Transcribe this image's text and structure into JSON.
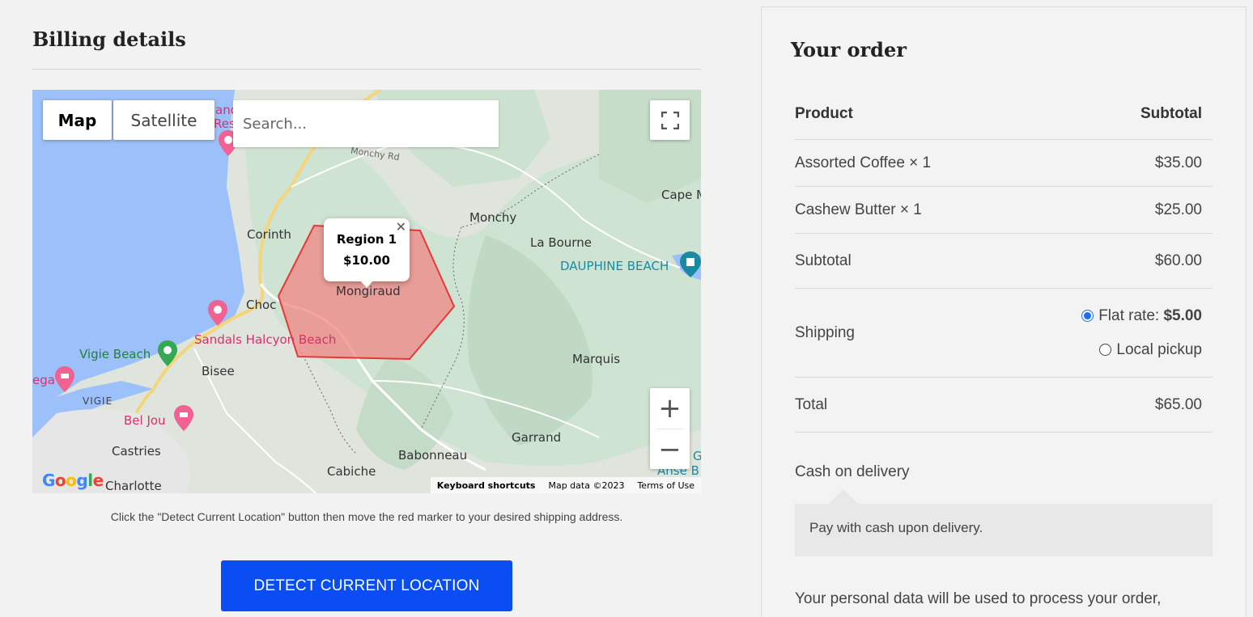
{
  "billing": {
    "title": "Billing details"
  },
  "map": {
    "type_map": "Map",
    "type_satellite": "Satellite",
    "search_placeholder": "Search...",
    "popup": {
      "region": "Region 1",
      "price": "$10.00"
    },
    "places": {
      "corinth": "Corinth",
      "monchy": "Monchy",
      "la_bourne": "La Bourne",
      "dauphine_beach": "DAUPHINE BEACH",
      "cape": "Cape M",
      "choc": "Choc",
      "sandals": "Sandals Halcyon Beach",
      "vigie_beach": "Vigie Beach",
      "bisee": "Bisee",
      "vigie": "VIGIE",
      "bel_jou": "Bel Jou",
      "castries": "Castries",
      "charlotte": "Charlotte",
      "cabiche": "Cabiche",
      "babonneau": "Babonneau",
      "garrand": "Garrand",
      "marquis": "Marquis",
      "monchy_rd": "Monchy Rd",
      "monchiraud": "Mongiraud",
      "anse": "Anse B",
      "ega": "ega",
      "res": "Res",
      "and": "and",
      "g": "G"
    },
    "footer": {
      "keyboard": "Keyboard shortcuts",
      "mapdata": "Map data ©2023",
      "terms": "Terms of Use"
    },
    "logo": "Google",
    "note": "Click the \"Detect Current Location\" button then move the red marker to your desired shipping address."
  },
  "detect_button": "DETECT CURRENT LOCATION",
  "order": {
    "title": "Your order",
    "head_product": "Product",
    "head_subtotal": "Subtotal",
    "items": [
      {
        "name": "Assorted Coffee × 1",
        "price": "$35.00"
      },
      {
        "name": "Cashew Butter × 1",
        "price": "$25.00"
      }
    ],
    "subtotal_label": "Subtotal",
    "subtotal_value": "$60.00",
    "shipping_label": "Shipping",
    "shipping_flat_label": "Flat rate: ",
    "shipping_flat_price": "$5.00",
    "shipping_local": "Local pickup",
    "total_label": "Total",
    "total_value": "$65.00",
    "payment_method": "Cash on delivery",
    "payment_desc": "Pay with cash upon delivery.",
    "privacy": "Your personal data will be used to process your order,"
  }
}
